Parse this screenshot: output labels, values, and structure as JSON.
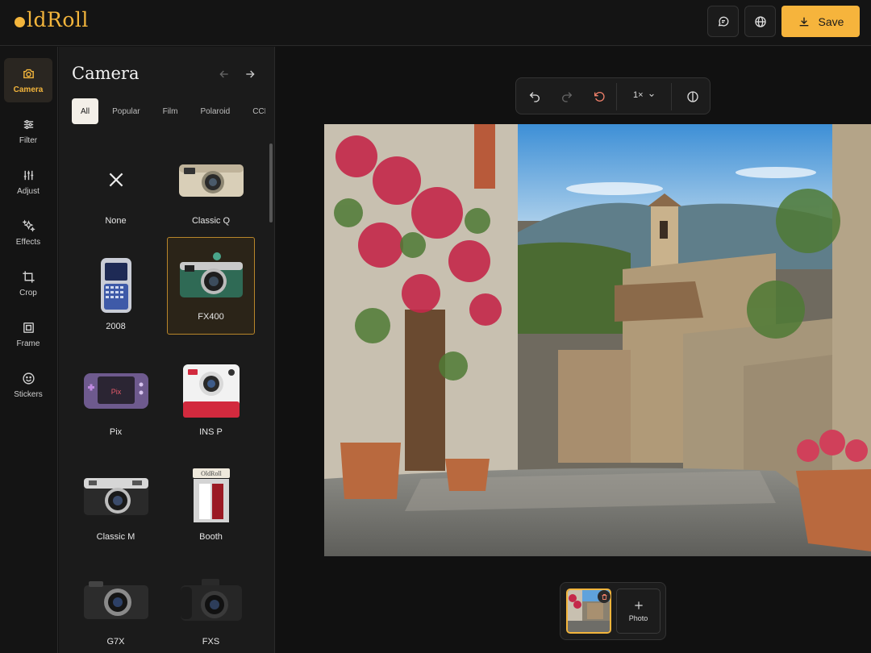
{
  "app": {
    "logo_text": "ldRoll",
    "accent": "#f3b53c"
  },
  "header": {
    "save_label": "Save"
  },
  "rail": {
    "items": [
      {
        "label": "Camera",
        "icon": "camera-icon",
        "active": true
      },
      {
        "label": "Filter",
        "icon": "sliders-icon"
      },
      {
        "label": "Adjust",
        "icon": "adjust-icon"
      },
      {
        "label": "Effects",
        "icon": "sparkles-icon"
      },
      {
        "label": "Crop",
        "icon": "crop-icon"
      },
      {
        "label": "Frame",
        "icon": "frame-icon"
      },
      {
        "label": "Stickers",
        "icon": "smile-icon"
      }
    ]
  },
  "panel": {
    "title": "Camera",
    "tabs": [
      "All",
      "Popular",
      "Film",
      "Polaroid",
      "CCD"
    ],
    "active_tab": "All",
    "cameras": [
      {
        "label": "None"
      },
      {
        "label": "Classic Q"
      },
      {
        "label": "2008"
      },
      {
        "label": "FX400",
        "selected": true
      },
      {
        "label": "Pix"
      },
      {
        "label": "INS P"
      },
      {
        "label": "Classic M"
      },
      {
        "label": "Booth"
      },
      {
        "label": "G7X"
      },
      {
        "label": "FXS"
      }
    ],
    "booth_sign": "OldRoll",
    "pix_screen_text": "Pix"
  },
  "toolbar": {
    "zoom_label": "1×"
  },
  "strip": {
    "add_label": "Photo"
  }
}
